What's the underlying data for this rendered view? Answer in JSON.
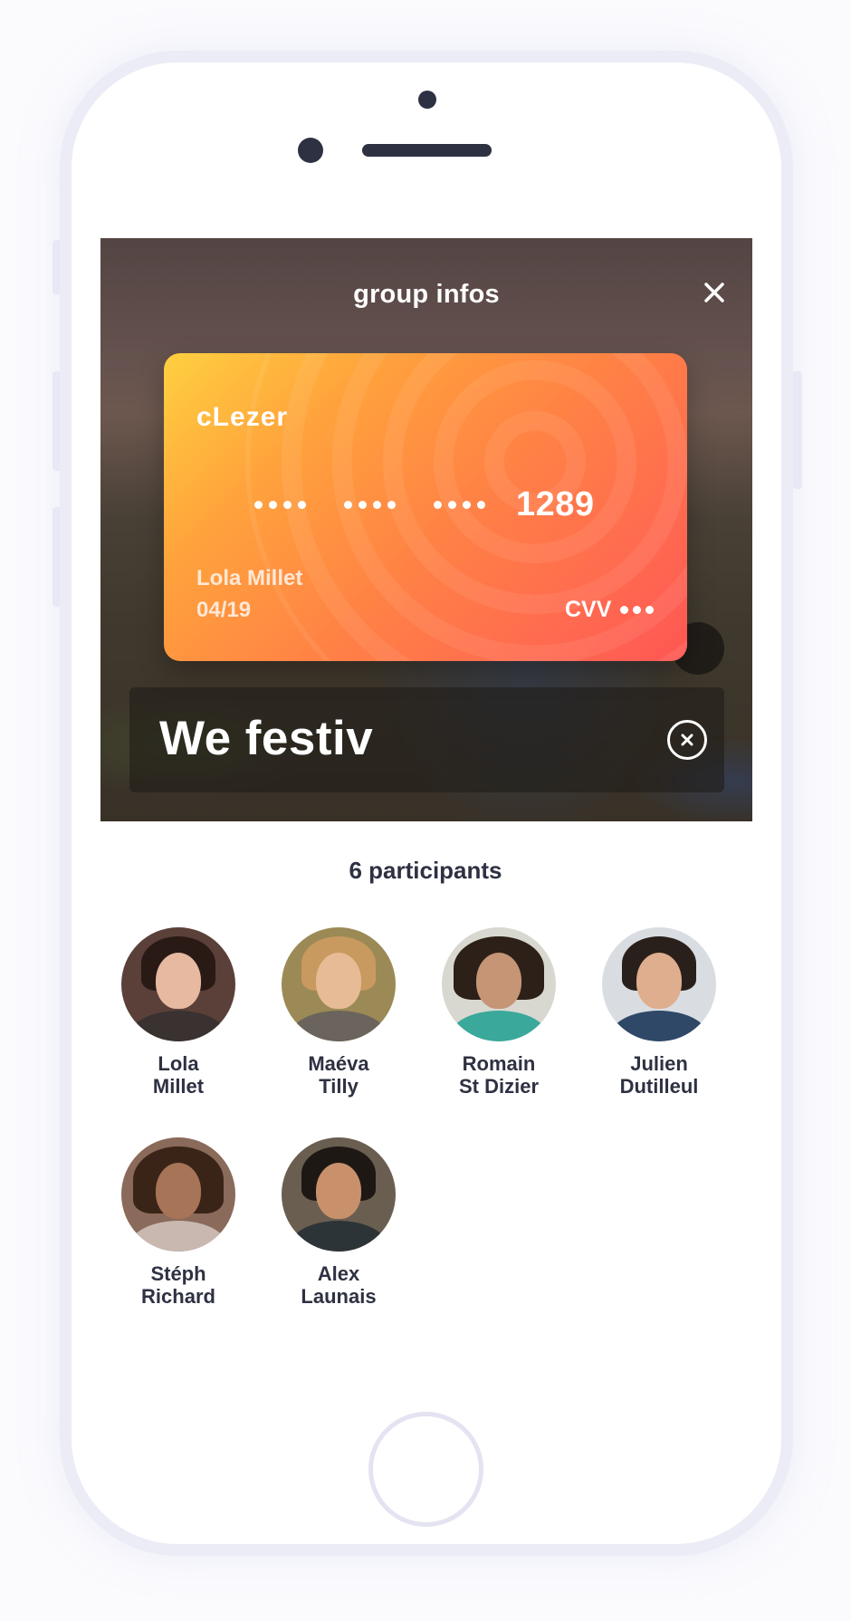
{
  "screen": {
    "title": "group infos",
    "close_icon": "close-icon"
  },
  "card": {
    "brand": "cLezer",
    "number_last4": "1289",
    "holder": "Lola Millet",
    "expiry": "04/19",
    "cvv_label": "CVV",
    "gradient_colors": [
      "#ffd040",
      "#ff8245",
      "#ff5653"
    ]
  },
  "group_name": {
    "value": "We festiv",
    "clear_icon": "clear-circle-icon"
  },
  "participants": {
    "count_label": "6 participants",
    "people": [
      {
        "first": "Lola",
        "last": "Millet"
      },
      {
        "first": "Maéva",
        "last": "Tilly"
      },
      {
        "first": "Romain",
        "last": "St Dizier"
      },
      {
        "first": "Julien",
        "last": "Dutilleul"
      },
      {
        "first": "Stéph",
        "last": "Richard"
      },
      {
        "first": "Alex",
        "last": "Launais"
      }
    ]
  },
  "colors": {
    "text_dark": "#2e3142",
    "phone_frame": "#ececf7"
  }
}
